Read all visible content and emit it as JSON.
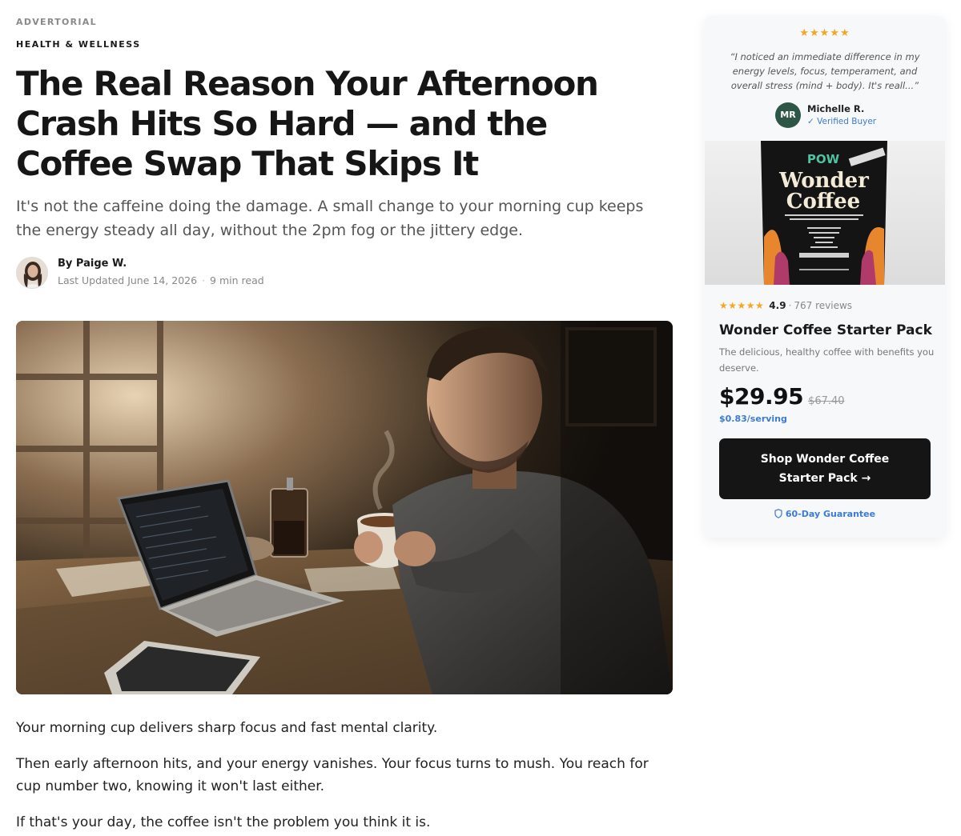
{
  "article": {
    "eyebrow": "ADVERTORIAL",
    "category": "HEALTH & WELLNESS",
    "headline": "The Real Reason Your Afternoon Crash Hits So Hard — and the Coffee Swap That Skips It",
    "dek": "It's not the caffeine doing the damage. A small change to your morning cup keeps the energy steady all day, without the 2pm fog or the jittery edge.",
    "author": "By Paige W.",
    "updated": "Last Updated June 14, 2026",
    "read_time": "9 min read",
    "paragraphs": [
      "Your morning cup delivers sharp focus and fast mental clarity.",
      "Then early afternoon hits, and your energy vanishes. Your focus turns to mush. You reach for cup number two, knowing it won't last either.",
      "If that's your day, the coffee isn't the problem you think it is."
    ]
  },
  "sidebar": {
    "stars": "★★★★★",
    "quote": "“I noticed an immediate difference in my energy levels, focus, temperament, and overall stress (mind + body). It's reall...”",
    "reviewer_initials": "MR",
    "reviewer_name": "Michelle R.",
    "verified": "✓ Verified Buyer",
    "product_stars": "★★★★★",
    "rating": "4.9",
    "reviews": "767 reviews",
    "product_title": "Wonder Coffee Starter Pack",
    "product_desc": "The delicious, healthy coffee with benefits you deserve.",
    "price": "$29.95",
    "old_price": "$67.40",
    "per_serving": "$0.83/serving",
    "cta_label": "Shop Wonder Coffee Starter Pack →",
    "guarantee": "60-Day Guarantee",
    "package": {
      "brand": "POW",
      "name_line1": "Wonder",
      "name_line2": "Coffee"
    }
  },
  "icons": {
    "star": "star-icon",
    "check": "check-icon",
    "shield": "shield-icon",
    "arrow": "arrow-right-icon"
  },
  "colors": {
    "accent_blue": "#3b7bd6",
    "star_gold": "#f5a623",
    "cta_bg": "#151515",
    "avatar_green": "#2e5646"
  }
}
